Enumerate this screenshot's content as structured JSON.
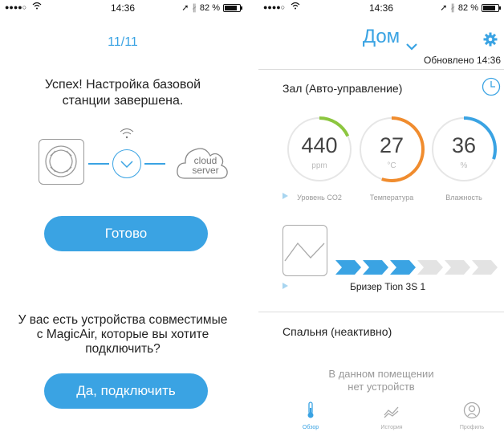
{
  "left_screen": {
    "status_bar": {
      "signal": "●●●●○",
      "time": "14:36",
      "battery": "82 %"
    },
    "step_indicator": "11/11",
    "success_message": "Успех! Настройка базовой станции завершена.",
    "cloud_label_line1": "cloud",
    "cloud_label_line2": "server",
    "done_button": "Готово",
    "question": "У вас есть устройства совместимые с MagicAir, которые вы хотите подключить?",
    "connect_button": "Да, подключить"
  },
  "right_screen": {
    "status_bar": {
      "signal": "●●●●○",
      "time": "14:36",
      "battery": "82 %"
    },
    "home_title": "Дом",
    "updated": "Обновлено 14:36",
    "room1": {
      "title": "Зал (Авто-управление)",
      "gauges": [
        {
          "value": "440",
          "unit": "ppm",
          "label": "Уровень CO2",
          "color": "#8cc63f",
          "fraction": 0.18
        },
        {
          "value": "27",
          "unit": "°C",
          "label": "Температура",
          "color": "#f08c2e",
          "fraction": 0.55
        },
        {
          "value": "36",
          "unit": "%",
          "label": "Влажность",
          "color": "#3aa3e3",
          "fraction": 0.3
        }
      ],
      "breezer_name": "Бризер Tion 3S 1",
      "breezer_level": 3,
      "breezer_max": 6
    },
    "room2": {
      "title": "Спальня (неактивно)",
      "empty_message_line1": "В данном помещении",
      "empty_message_line2": "нет устройств"
    },
    "tabs": [
      {
        "label": "Обзор",
        "icon": "thermometer-icon",
        "active": true
      },
      {
        "label": "История",
        "icon": "chart-icon",
        "active": false
      },
      {
        "label": "Профиль",
        "icon": "profile-icon",
        "active": false
      }
    ],
    "accent_color": "#3aa3e3"
  }
}
